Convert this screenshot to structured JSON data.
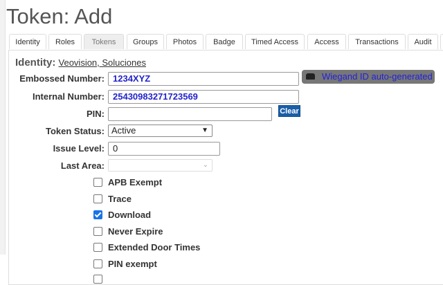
{
  "page_title": "Token: Add",
  "tabs": [
    "Identity",
    "Roles",
    "Tokens",
    "Groups",
    "Photos",
    "Badge",
    "Timed Access",
    "Access",
    "Transactions",
    "Audit"
  ],
  "active_tab": "Tokens",
  "identity": {
    "label": "Identity:",
    "name": "Veovision, Soluciones"
  },
  "form": {
    "embossed_label": "Embossed Number:",
    "embossed_value": "1234XYZ",
    "wiegand_note": "Wiegand ID auto-generated",
    "internal_label": "Internal Number:",
    "internal_value": "25430983271723569",
    "pin_label": "PIN:",
    "pin_value": "",
    "clear_label": "Clear",
    "status_label": "Token Status:",
    "status_value": "Active",
    "issue_label": "Issue Level:",
    "issue_value": "0",
    "last_area_label": "Last Area:",
    "last_area_value": ""
  },
  "checkboxes": [
    {
      "label": "APB Exempt",
      "checked": false
    },
    {
      "label": "Trace",
      "checked": false
    },
    {
      "label": "Download",
      "checked": true
    },
    {
      "label": "Never Expire",
      "checked": false
    },
    {
      "label": "Extended Door Times",
      "checked": false
    },
    {
      "label": "PIN exempt",
      "checked": false
    }
  ]
}
